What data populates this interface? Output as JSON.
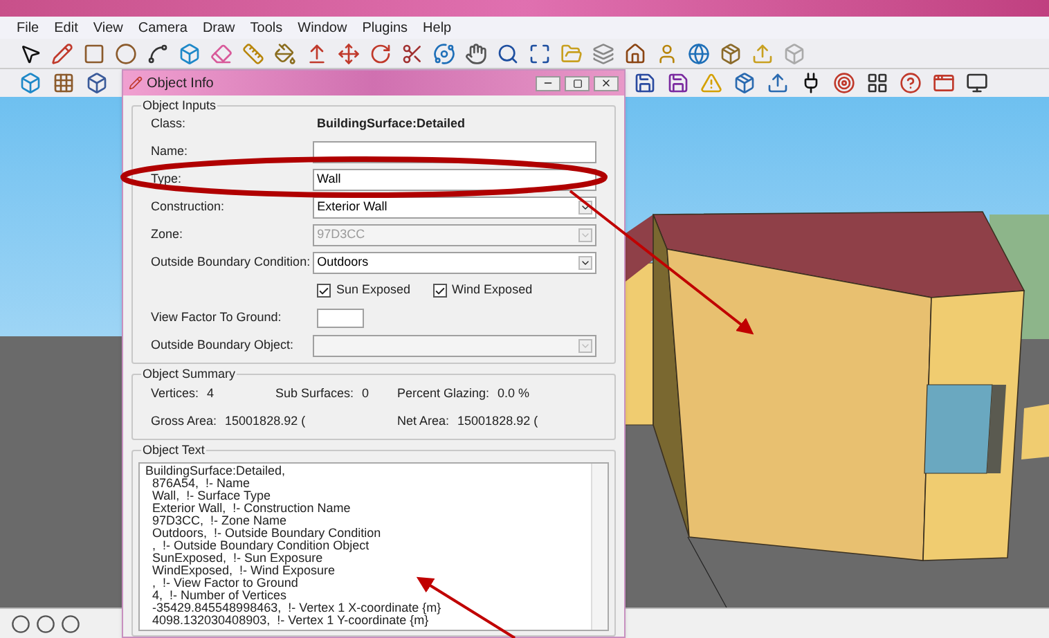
{
  "menu": [
    "File",
    "Edit",
    "View",
    "Camera",
    "Draw",
    "Tools",
    "Window",
    "Plugins",
    "Help"
  ],
  "dialog": {
    "title": "Object Info",
    "inputs": {
      "legend": "Object Inputs",
      "fields": [
        {
          "kind": "static",
          "label": "Class:",
          "value": "BuildingSurface:Detailed"
        },
        {
          "kind": "text",
          "label": "Name:",
          "disabled": false
        },
        {
          "kind": "text",
          "label": "Type:",
          "value": "Wall",
          "disabled": false
        },
        {
          "kind": "dropdown",
          "label": "Construction:",
          "value": "Exterior Wall",
          "disabled": false
        },
        {
          "kind": "dropdown",
          "label": "Zone:",
          "value": "97D3CC",
          "disabled": true
        },
        {
          "kind": "dropdown",
          "label": "Outside Boundary Condition:",
          "value": "Outdoors",
          "disabled": false
        },
        {
          "kind": "checkboxes",
          "items": [
            {
              "label": "Sun Exposed",
              "checked": true
            },
            {
              "label": "Wind Exposed",
              "checked": true
            }
          ]
        },
        {
          "kind": "short",
          "label": "View Factor To Ground:"
        },
        {
          "kind": "dropdown",
          "label": "Outside Boundary Object:",
          "disabled": true
        }
      ]
    },
    "summary": {
      "legend": "Object Summary",
      "rows": [
        [
          {
            "label": "Vertices:",
            "value": "4"
          },
          {
            "label": "Sub Surfaces:",
            "value": "0"
          },
          {
            "label": "Percent Glazing:",
            "value": "0.0 %"
          }
        ],
        [
          {
            "label": "Gross Area:",
            "value": "15001828.92 ("
          },
          "",
          {
            "label": "Net Area:",
            "value": "15001828.92 ("
          }
        ]
      ]
    },
    "object_text": {
      "legend": "Object Text",
      "lines": [
        "BuildingSurface:Detailed,",
        "  876A54,  !- Name",
        "  Wall,  !- Surface Type",
        "  Exterior Wall,  !- Construction Name",
        "  97D3CC,  !- Zone Name",
        "  Outdoors,  !- Outside Boundary Condition",
        "  ,  !- Outside Boundary Condition Object",
        "  SunExposed,  !- Sun Exposure",
        "  WindExposed,  !- Wind Exposure",
        "  ,  !- View Factor to Ground",
        "  4,  !- Number of Vertices",
        "  -35429.845548998463,  !- Vertex 1 X-coordinate {m}",
        "  4098.132030408903,  !- Vertex 1 Y-coordinate {m}"
      ]
    }
  }
}
